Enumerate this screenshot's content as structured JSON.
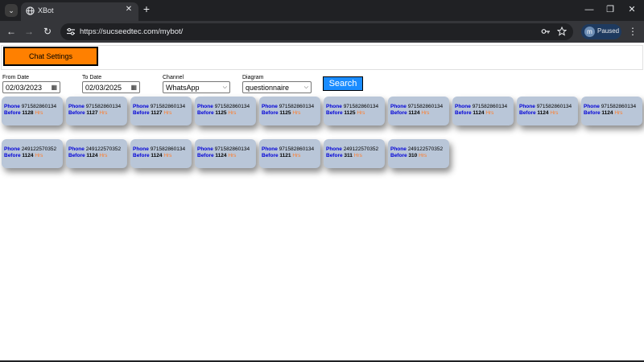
{
  "browser": {
    "tab_title": "XBot",
    "url": "https://sucseedtec.com/mybot/",
    "profile_initial": "m",
    "profile_status": "Paused"
  },
  "page": {
    "chat_settings_label": "Chat Settings",
    "filters": {
      "from_date": {
        "label": "From Date",
        "value": "02/03/2023"
      },
      "to_date": {
        "label": "To Date",
        "value": "02/03/2025"
      },
      "channel": {
        "label": "Channel",
        "value": "WhatsApp"
      },
      "diagram": {
        "label": "Diagram",
        "value": "questionnaire"
      }
    },
    "search_label": "Search",
    "card_labels": {
      "phone": "Phone",
      "before": "Before",
      "hrs": "Hrs"
    },
    "cards": [
      {
        "phone": "971582860134",
        "before": "1128"
      },
      {
        "phone": "971582860134",
        "before": "1127"
      },
      {
        "phone": "971582860134",
        "before": "1127"
      },
      {
        "phone": "971582860134",
        "before": "1125"
      },
      {
        "phone": "971582860134",
        "before": "1125"
      },
      {
        "phone": "971582860134",
        "before": "1125"
      },
      {
        "phone": "971582860134",
        "before": "1124"
      },
      {
        "phone": "971582860134",
        "before": "1124"
      },
      {
        "phone": "971582860134",
        "before": "1124"
      },
      {
        "phone": "971582860134",
        "before": "1124"
      },
      {
        "phone": "249122570352",
        "before": "1124"
      },
      {
        "phone": "249122570352",
        "before": "1124"
      },
      {
        "phone": "971582860134",
        "before": "1124"
      },
      {
        "phone": "971582860134",
        "before": "1124"
      },
      {
        "phone": "971582860134",
        "before": "1121"
      },
      {
        "phone": "249122570352",
        "before": "311"
      },
      {
        "phone": "249122570352",
        "before": "310"
      }
    ]
  },
  "colors": {
    "button_orange": "#ff8000",
    "search_blue": "#1a8cff",
    "card_bg": "#b9c6d8",
    "label_blue": "#0000d8",
    "hrs_orange": "#ff7c2a"
  }
}
